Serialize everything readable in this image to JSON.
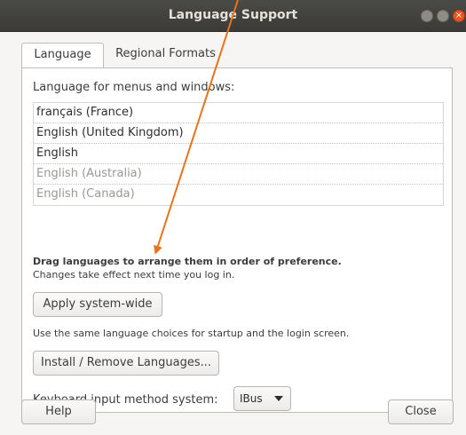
{
  "window": {
    "title": "Language Support",
    "close_glyph": "×"
  },
  "tabs": [
    {
      "label": "Language",
      "active": true
    },
    {
      "label": "Regional Formats",
      "active": false
    }
  ],
  "language": {
    "section_label": "Language for menus and windows:",
    "items": [
      {
        "label": "français (France)"
      },
      {
        "label": "English (United Kingdom)"
      },
      {
        "label": "English"
      },
      {
        "label": "English (Australia)"
      },
      {
        "label": "English (Canada)"
      }
    ],
    "hint_bold": "Drag languages to arrange them in order of preference.",
    "hint_normal": "Changes take effect next time you log in.",
    "apply_button": "Apply system-wide",
    "apply_note": "Use the same language choices for startup and the login screen.",
    "install_button": "Install / Remove Languages...",
    "keyboard_label": "Keyboard input method system:",
    "keyboard_value": "IBus"
  },
  "footer": {
    "help": "Help",
    "close": "Close"
  },
  "colors": {
    "titlebar": "#3c3b37",
    "accent_close": "#e95420",
    "annotation_arrow": "#e8731a"
  },
  "icons": {
    "wm_close": "close-icon",
    "wm_min": "minimize-icon",
    "wm_max": "maximize-icon",
    "select_chevron": "chevron-down-icon"
  }
}
